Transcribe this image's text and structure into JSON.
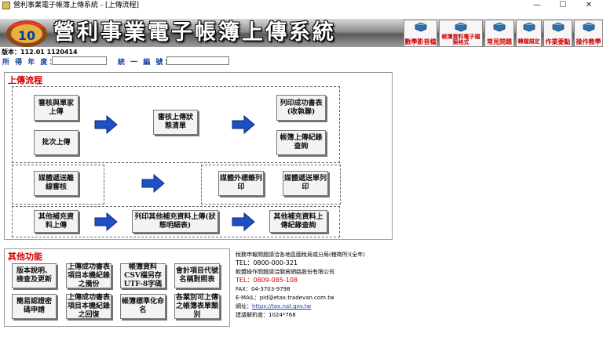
{
  "window": {
    "title": "營利事業電子帳簿上傳系統 - [上傳流程]",
    "minimize": "—",
    "maximize": "☐",
    "close": "✕"
  },
  "banner": {
    "logo_text": "10",
    "title": "營利事業電子帳簿上傳系統"
  },
  "top_buttons": [
    {
      "label": "數學影音檔",
      "icon": "book-icon"
    },
    {
      "label": "帳簿資料電子檔案格式",
      "icon": "book-icon"
    },
    {
      "label": "常見問題",
      "icon": "book-icon"
    },
    {
      "label": "轉檔規定",
      "icon": "book-icon"
    },
    {
      "label": "作業要點",
      "icon": "book-icon"
    },
    {
      "label": "操作教學",
      "icon": "book-icon"
    }
  ],
  "version": "版本：112.01 1120414",
  "fields": {
    "year_label": "所 得 年 度：",
    "year_value": "",
    "ban_label": "統 一 編 號：",
    "ban_value": ""
  },
  "upload_section": {
    "title": "上傳流程",
    "review_unit": "審核與單家上傳",
    "batch_upload": "批次上傳",
    "review_status": "審核上傳狀態清單",
    "print_receipt": "列印成功書表(收執聯)",
    "ledger_query": "帳簿上傳紀錄查詢",
    "media_review": "媒體遞送離線審核",
    "media_label_print": "媒體外標籤列印",
    "media_list_print": "媒體遞送單列印",
    "other_upload": "其他補充資料上傳",
    "other_print": "列印其他補充資料上傳(狀態明細表)",
    "other_query": "其他補充資料上傳紀錄查詢"
  },
  "other_section": {
    "title": "其他功能",
    "buttons": [
      "版本說明、檢查及更新",
      "上傳成功書表項目本機紀錄之備份",
      "帳簿資料CSV檔另存UTF-8字碼",
      "會計項目代號名稱對照表",
      "簡易認證密碼申請",
      "上傳成功書表項目本機紀錄之回復",
      "帳簿標準化命名",
      "各業別可上傳之帳簿表單類別"
    ]
  },
  "contact": {
    "line1": "稅務申報問題請洽各地區國稅局或分局(稽徵所)(全年)",
    "line2": "TEL：0800-000-321",
    "line3": "軟體操作問題請洽關貿網路股份有限公司",
    "line4": "TEL：0809-085-108",
    "line5": "FAX：04-3703-9798",
    "line6": "E-MAIL：pid@etax.tradevan.com.tw",
    "line7_label": "網址：",
    "line7_link": "https://tax.nat.gov.tw",
    "line8": "建議解析度：1024*768"
  },
  "colors": {
    "accent_red": "#d40000",
    "accent_blue": "#1a3ea0",
    "arrow_blue": "#1f4fc2"
  }
}
